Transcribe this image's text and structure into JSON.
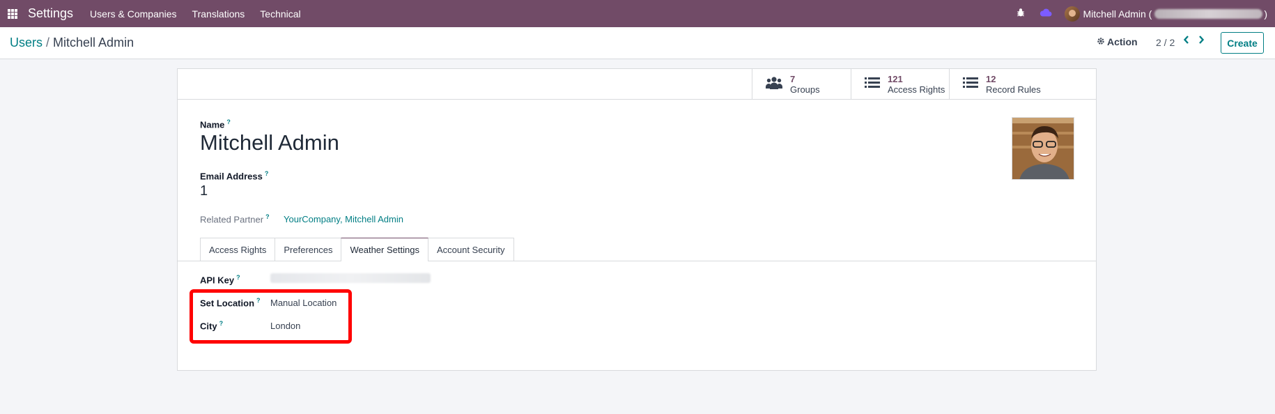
{
  "navbar": {
    "app_name": "Settings",
    "menu": [
      "Users & Companies",
      "Translations",
      "Technical"
    ],
    "user_name": "Mitchell Admin (",
    "user_suffix": ")",
    "accent": "#714b67"
  },
  "control_panel": {
    "breadcrumb_parent": "Users",
    "breadcrumb_separator": "/",
    "breadcrumb_current": "Mitchell Admin",
    "action_label": "Action",
    "pager": "2 / 2",
    "create_label": "Create"
  },
  "stat_buttons": [
    {
      "value": "7",
      "label": "Groups",
      "icon": "users-icon"
    },
    {
      "value": "121",
      "label": "Access Rights",
      "icon": "list-icon"
    },
    {
      "value": "12",
      "label": "Record Rules",
      "icon": "list-icon"
    }
  ],
  "form": {
    "name_label": "Name",
    "name_value": "Mitchell Admin",
    "email_label": "Email Address",
    "email_value": "1",
    "partner_label": "Related Partner",
    "partner_value": "YourCompany, Mitchell Admin",
    "help_marker": "?"
  },
  "tabs": [
    "Access Rights",
    "Preferences",
    "Weather Settings",
    "Account Security"
  ],
  "active_tab": "Weather Settings",
  "weather": {
    "api_key_label": "API Key",
    "set_location_label": "Set Location",
    "set_location_value": "Manual Location",
    "city_label": "City",
    "city_value": "London"
  }
}
